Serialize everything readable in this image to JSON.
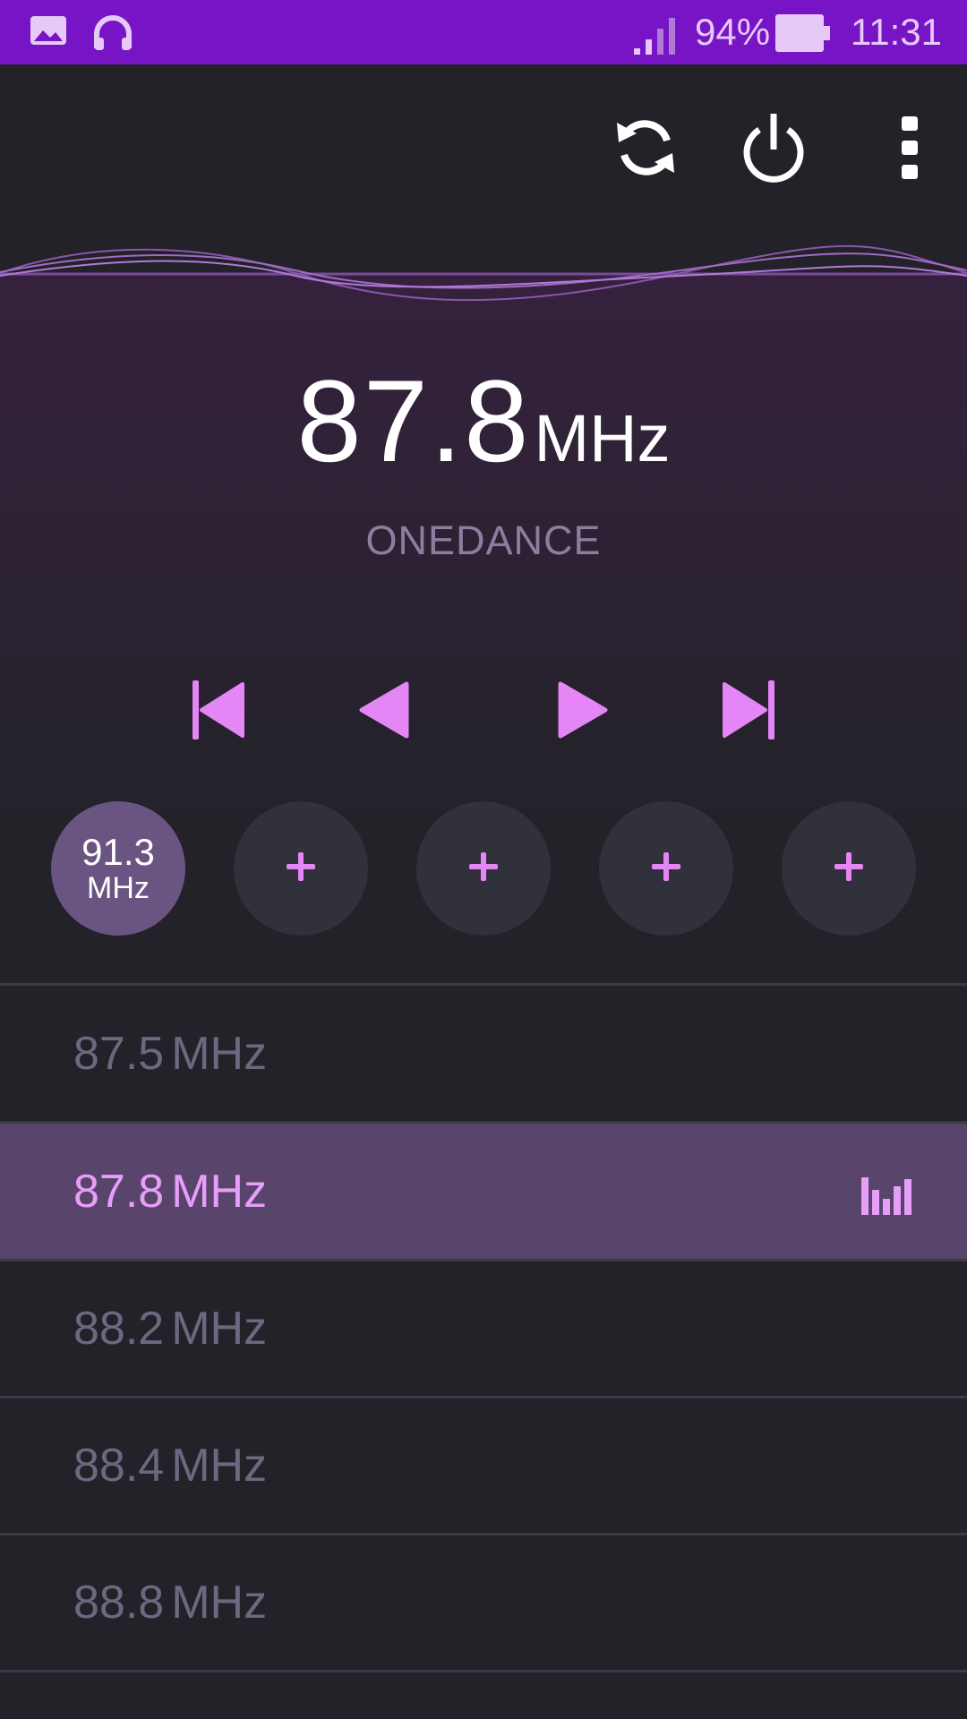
{
  "status_bar": {
    "battery": "94%",
    "time": "11:31",
    "icons": [
      "gallery-icon",
      "headphones-icon",
      "signal-icon",
      "battery-icon"
    ]
  },
  "toolbar": {
    "icons": [
      "refresh-icon",
      "power-icon",
      "overflow-menu-icon"
    ]
  },
  "now_playing": {
    "frequency": "87.8",
    "unit": "MHz",
    "station_name": "ONEDANCE"
  },
  "controls": [
    "skip-previous-icon",
    "seek-back-icon",
    "seek-forward-icon",
    "skip-next-icon"
  ],
  "presets": [
    {
      "number": "91.3",
      "unit": "MHz",
      "active": true
    },
    {
      "label": "+",
      "active": false
    },
    {
      "label": "+",
      "active": false
    },
    {
      "label": "+",
      "active": false
    },
    {
      "label": "+",
      "active": false
    }
  ],
  "station_list": [
    {
      "frequency": "87.5",
      "unit": "MHz",
      "active": false
    },
    {
      "frequency": "87.8",
      "unit": "MHz",
      "active": true
    },
    {
      "frequency": "88.2",
      "unit": "MHz",
      "active": false
    },
    {
      "frequency": "88.4",
      "unit": "MHz",
      "active": false
    },
    {
      "frequency": "88.8",
      "unit": "MHz",
      "active": false
    }
  ],
  "colors": {
    "status_bar": "#7714c6",
    "accent": "#e79ef9",
    "background": "#222228",
    "active_row": "#59446b",
    "active_preset": "#6a5582"
  }
}
